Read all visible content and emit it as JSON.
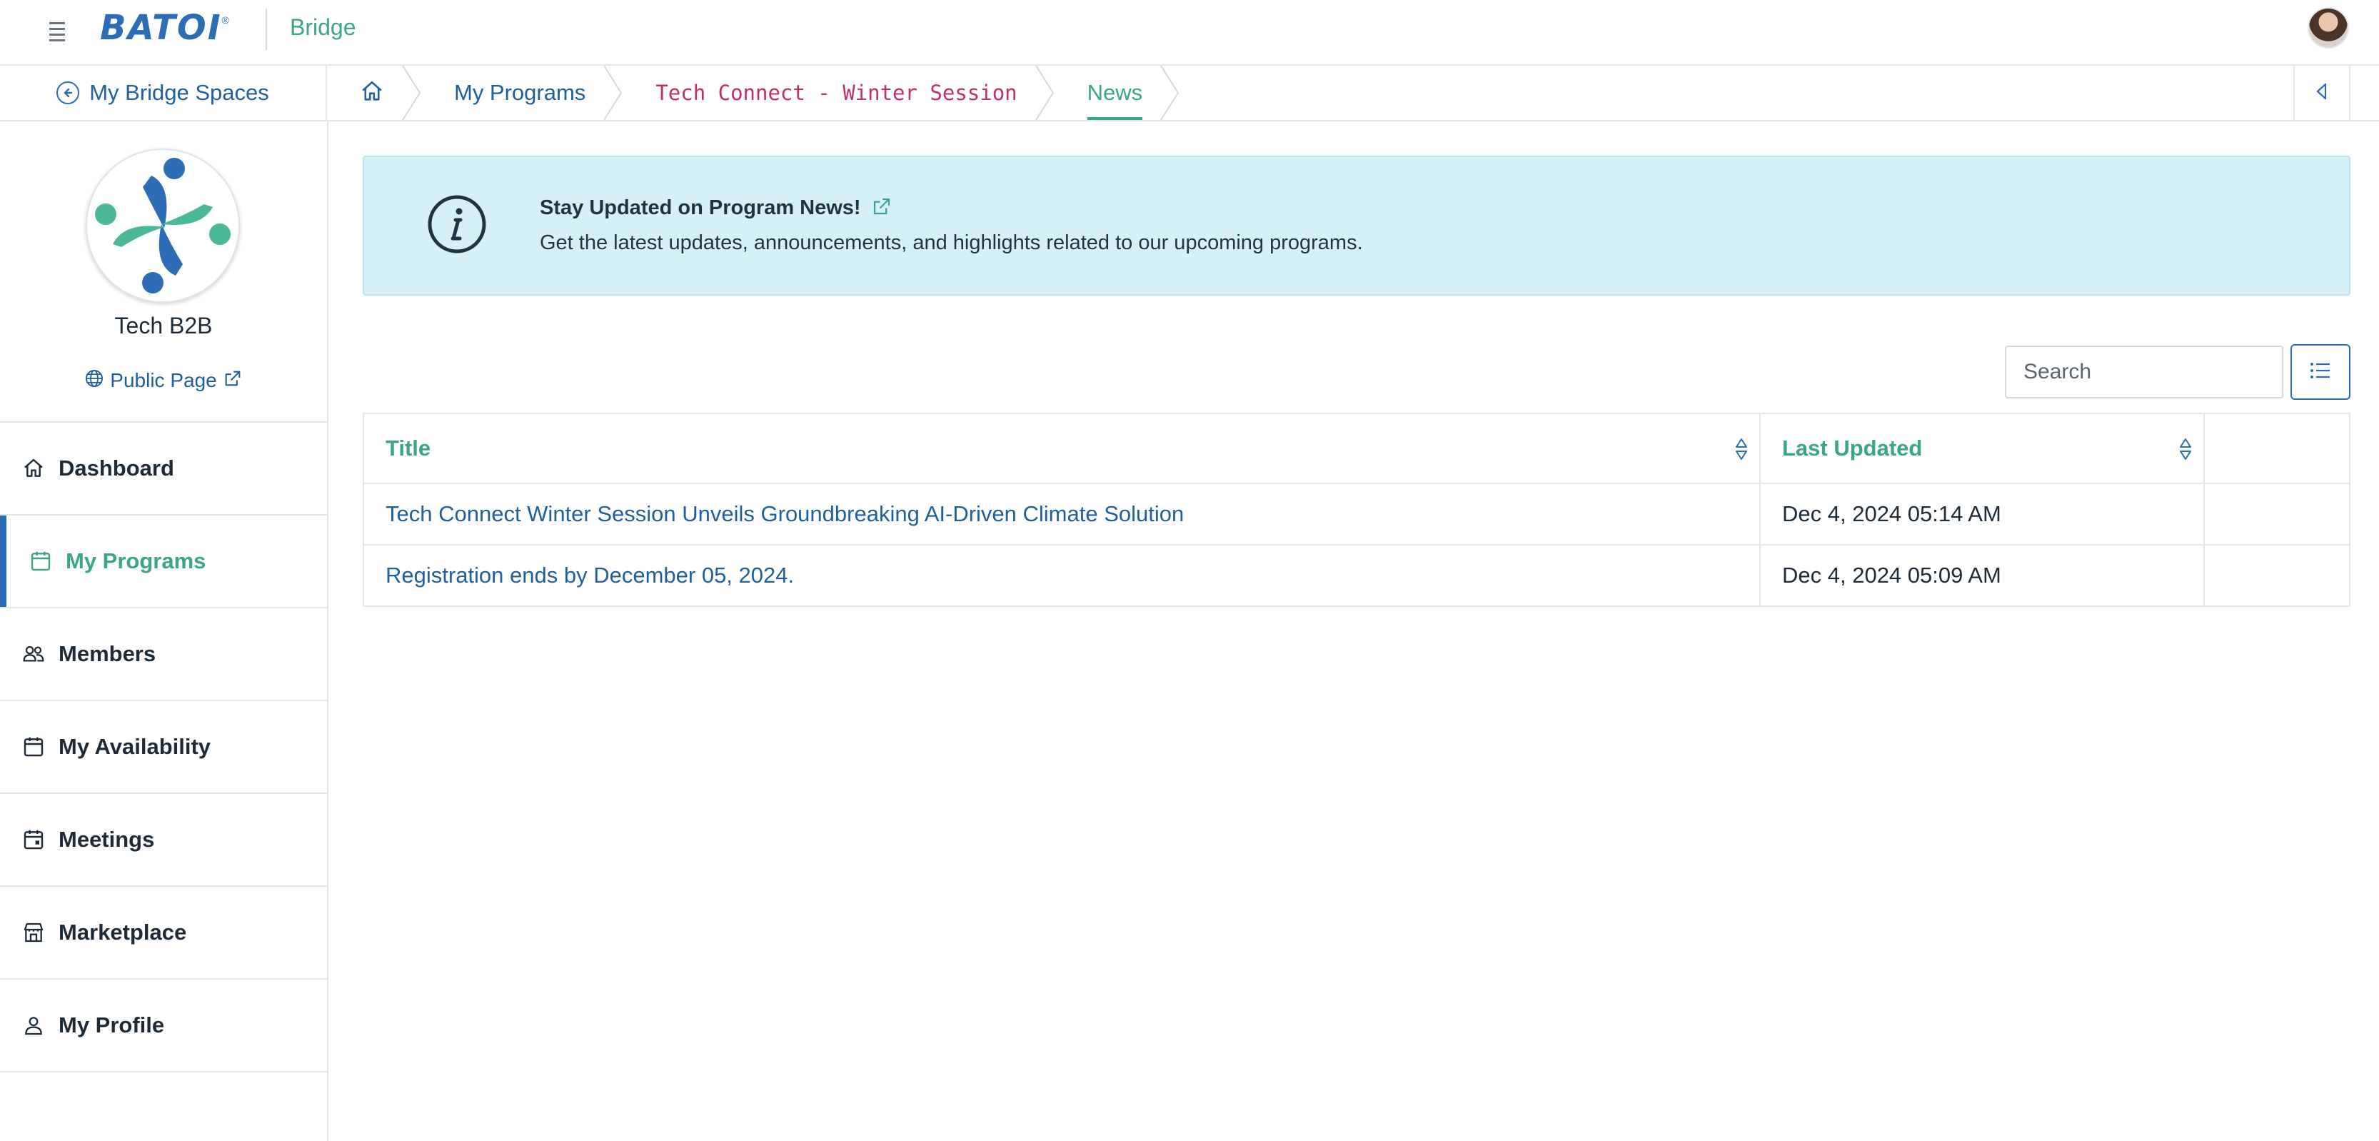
{
  "app": {
    "logo_text": "BATOI",
    "logo_reg": "®",
    "name": "Bridge"
  },
  "breadcrumb": {
    "back_label": "My Bridge Spaces",
    "items": [
      {
        "label": "My Programs"
      },
      {
        "label": "Tech Connect - Winter Session"
      },
      {
        "label": "News"
      }
    ]
  },
  "sidebar": {
    "org_name": "Tech B2B",
    "public_page_label": "Public Page",
    "items": [
      {
        "label": "Dashboard",
        "icon": "home-icon"
      },
      {
        "label": "My Programs",
        "icon": "calendar-icon",
        "active": true
      },
      {
        "label": "Members",
        "icon": "users-icon"
      },
      {
        "label": "My Availability",
        "icon": "calendar-icon"
      },
      {
        "label": "Meetings",
        "icon": "calendar-event-icon"
      },
      {
        "label": "Marketplace",
        "icon": "shop-icon"
      },
      {
        "label": "My Profile",
        "icon": "person-icon"
      }
    ]
  },
  "banner": {
    "title": "Stay Updated on Program News!",
    "text": "Get the latest updates, announcements, and highlights related to our upcoming programs."
  },
  "search": {
    "placeholder": "Search",
    "value": ""
  },
  "table": {
    "columns": [
      "Title",
      "Last Updated",
      ""
    ],
    "rows": [
      {
        "title": "Tech Connect Winter Session Unveils Groundbreaking AI-Driven Climate Solution",
        "updated": "Dec 4, 2024 05:14 AM"
      },
      {
        "title": "Registration ends by December 05, 2024.",
        "updated": "Dec 4, 2024 05:09 AM"
      }
    ]
  },
  "colors": {
    "brand_blue": "#2c6db5",
    "accent_green": "#3aa58a",
    "link_blue": "#1f5f9e",
    "banner_bg": "#d6f0f7",
    "mono_pink": "#c0306b"
  }
}
